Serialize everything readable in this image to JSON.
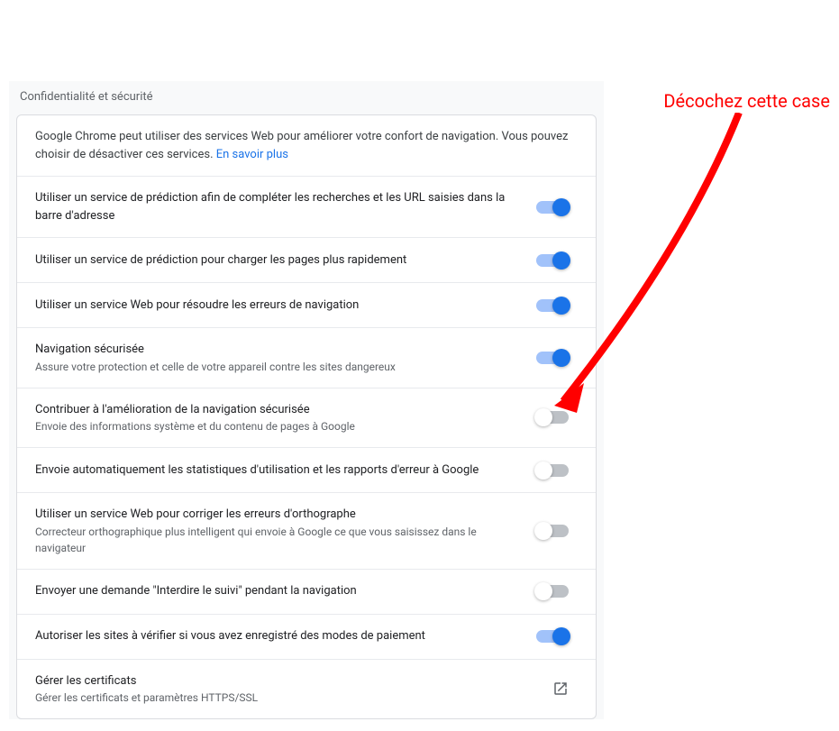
{
  "annotation": "Décochez cette case",
  "section_title": "Confidentialité et sécurité",
  "intro": {
    "text": "Google Chrome peut utiliser des services Web pour améliorer votre confort de navigation. Vous pouvez choisir de désactiver ces services. ",
    "link": "En savoir plus"
  },
  "settings": [
    {
      "title": "Utiliser un service de prédiction afin de compléter les recherches et les URL saisies dans la barre d'adresse",
      "desc": "",
      "state": "on"
    },
    {
      "title": "Utiliser un service de prédiction pour charger les pages plus rapidement",
      "desc": "",
      "state": "on"
    },
    {
      "title": "Utiliser un service Web pour résoudre les erreurs de navigation",
      "desc": "",
      "state": "on"
    },
    {
      "title": "Navigation sécurisée",
      "desc": "Assure votre protection et celle de votre appareil contre les sites dangereux",
      "state": "on"
    },
    {
      "title": "Contribuer à l'amélioration de la navigation sécurisée",
      "desc": "Envoie des informations système et du contenu de pages à Google",
      "state": "off"
    },
    {
      "title": "Envoie automatiquement les statistiques d'utilisation et les rapports d'erreur à Google",
      "desc": "",
      "state": "off"
    },
    {
      "title": "Utiliser un service Web pour corriger les erreurs d'orthographe",
      "desc": "Correcteur orthographique plus intelligent qui envoie à Google ce que vous saisissez dans le navigateur",
      "state": "off"
    },
    {
      "title": "Envoyer une demande \"Interdire le suivi\" pendant la navigation",
      "desc": "",
      "state": "off"
    },
    {
      "title": "Autoriser les sites à vérifier si vous avez enregistré des modes de paiement",
      "desc": "",
      "state": "on"
    }
  ],
  "certificates": {
    "title": "Gérer les certificats",
    "desc": "Gérer les certificats et paramètres HTTPS/SSL"
  }
}
